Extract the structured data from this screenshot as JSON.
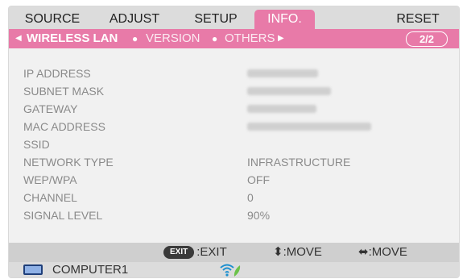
{
  "menu": {
    "tabs": [
      {
        "label": "SOURCE",
        "active": false
      },
      {
        "label": "ADJUST",
        "active": false
      },
      {
        "label": "SETUP",
        "active": false
      },
      {
        "label": "INFO.",
        "active": true
      },
      {
        "label": "RESET",
        "active": false
      }
    ]
  },
  "submenu": {
    "tabs": [
      {
        "label": "WIRELESS LAN",
        "active": true
      },
      {
        "label": "VERSION",
        "active": false
      },
      {
        "label": "OTHERS",
        "active": false
      }
    ],
    "page": "2/2"
  },
  "info_rows": [
    {
      "label": "IP ADDRESS",
      "value": "",
      "obscured": true
    },
    {
      "label": "SUBNET MASK",
      "value": "",
      "obscured": true
    },
    {
      "label": "GATEWAY",
      "value": "",
      "obscured": true
    },
    {
      "label": "MAC ADDRESS",
      "value": "",
      "obscured": true
    },
    {
      "label": "SSID",
      "value": ""
    },
    {
      "label": "NETWORK TYPE",
      "value": "INFRASTRUCTURE"
    },
    {
      "label": "WEP/WPA",
      "value": "OFF"
    },
    {
      "label": "CHANNEL",
      "value": "0"
    },
    {
      "label": "SIGNAL LEVEL",
      "value": "90%"
    }
  ],
  "footer": {
    "exit_key": "EXIT",
    "exit_label": ":EXIT",
    "move_vertical": "⬍:MOVE",
    "move_horizontal": "⬌:MOVE"
  },
  "status": {
    "input": "COMPUTER1"
  },
  "colors": {
    "accent": "#e87aa8",
    "label_text": "#8a8a8a"
  }
}
